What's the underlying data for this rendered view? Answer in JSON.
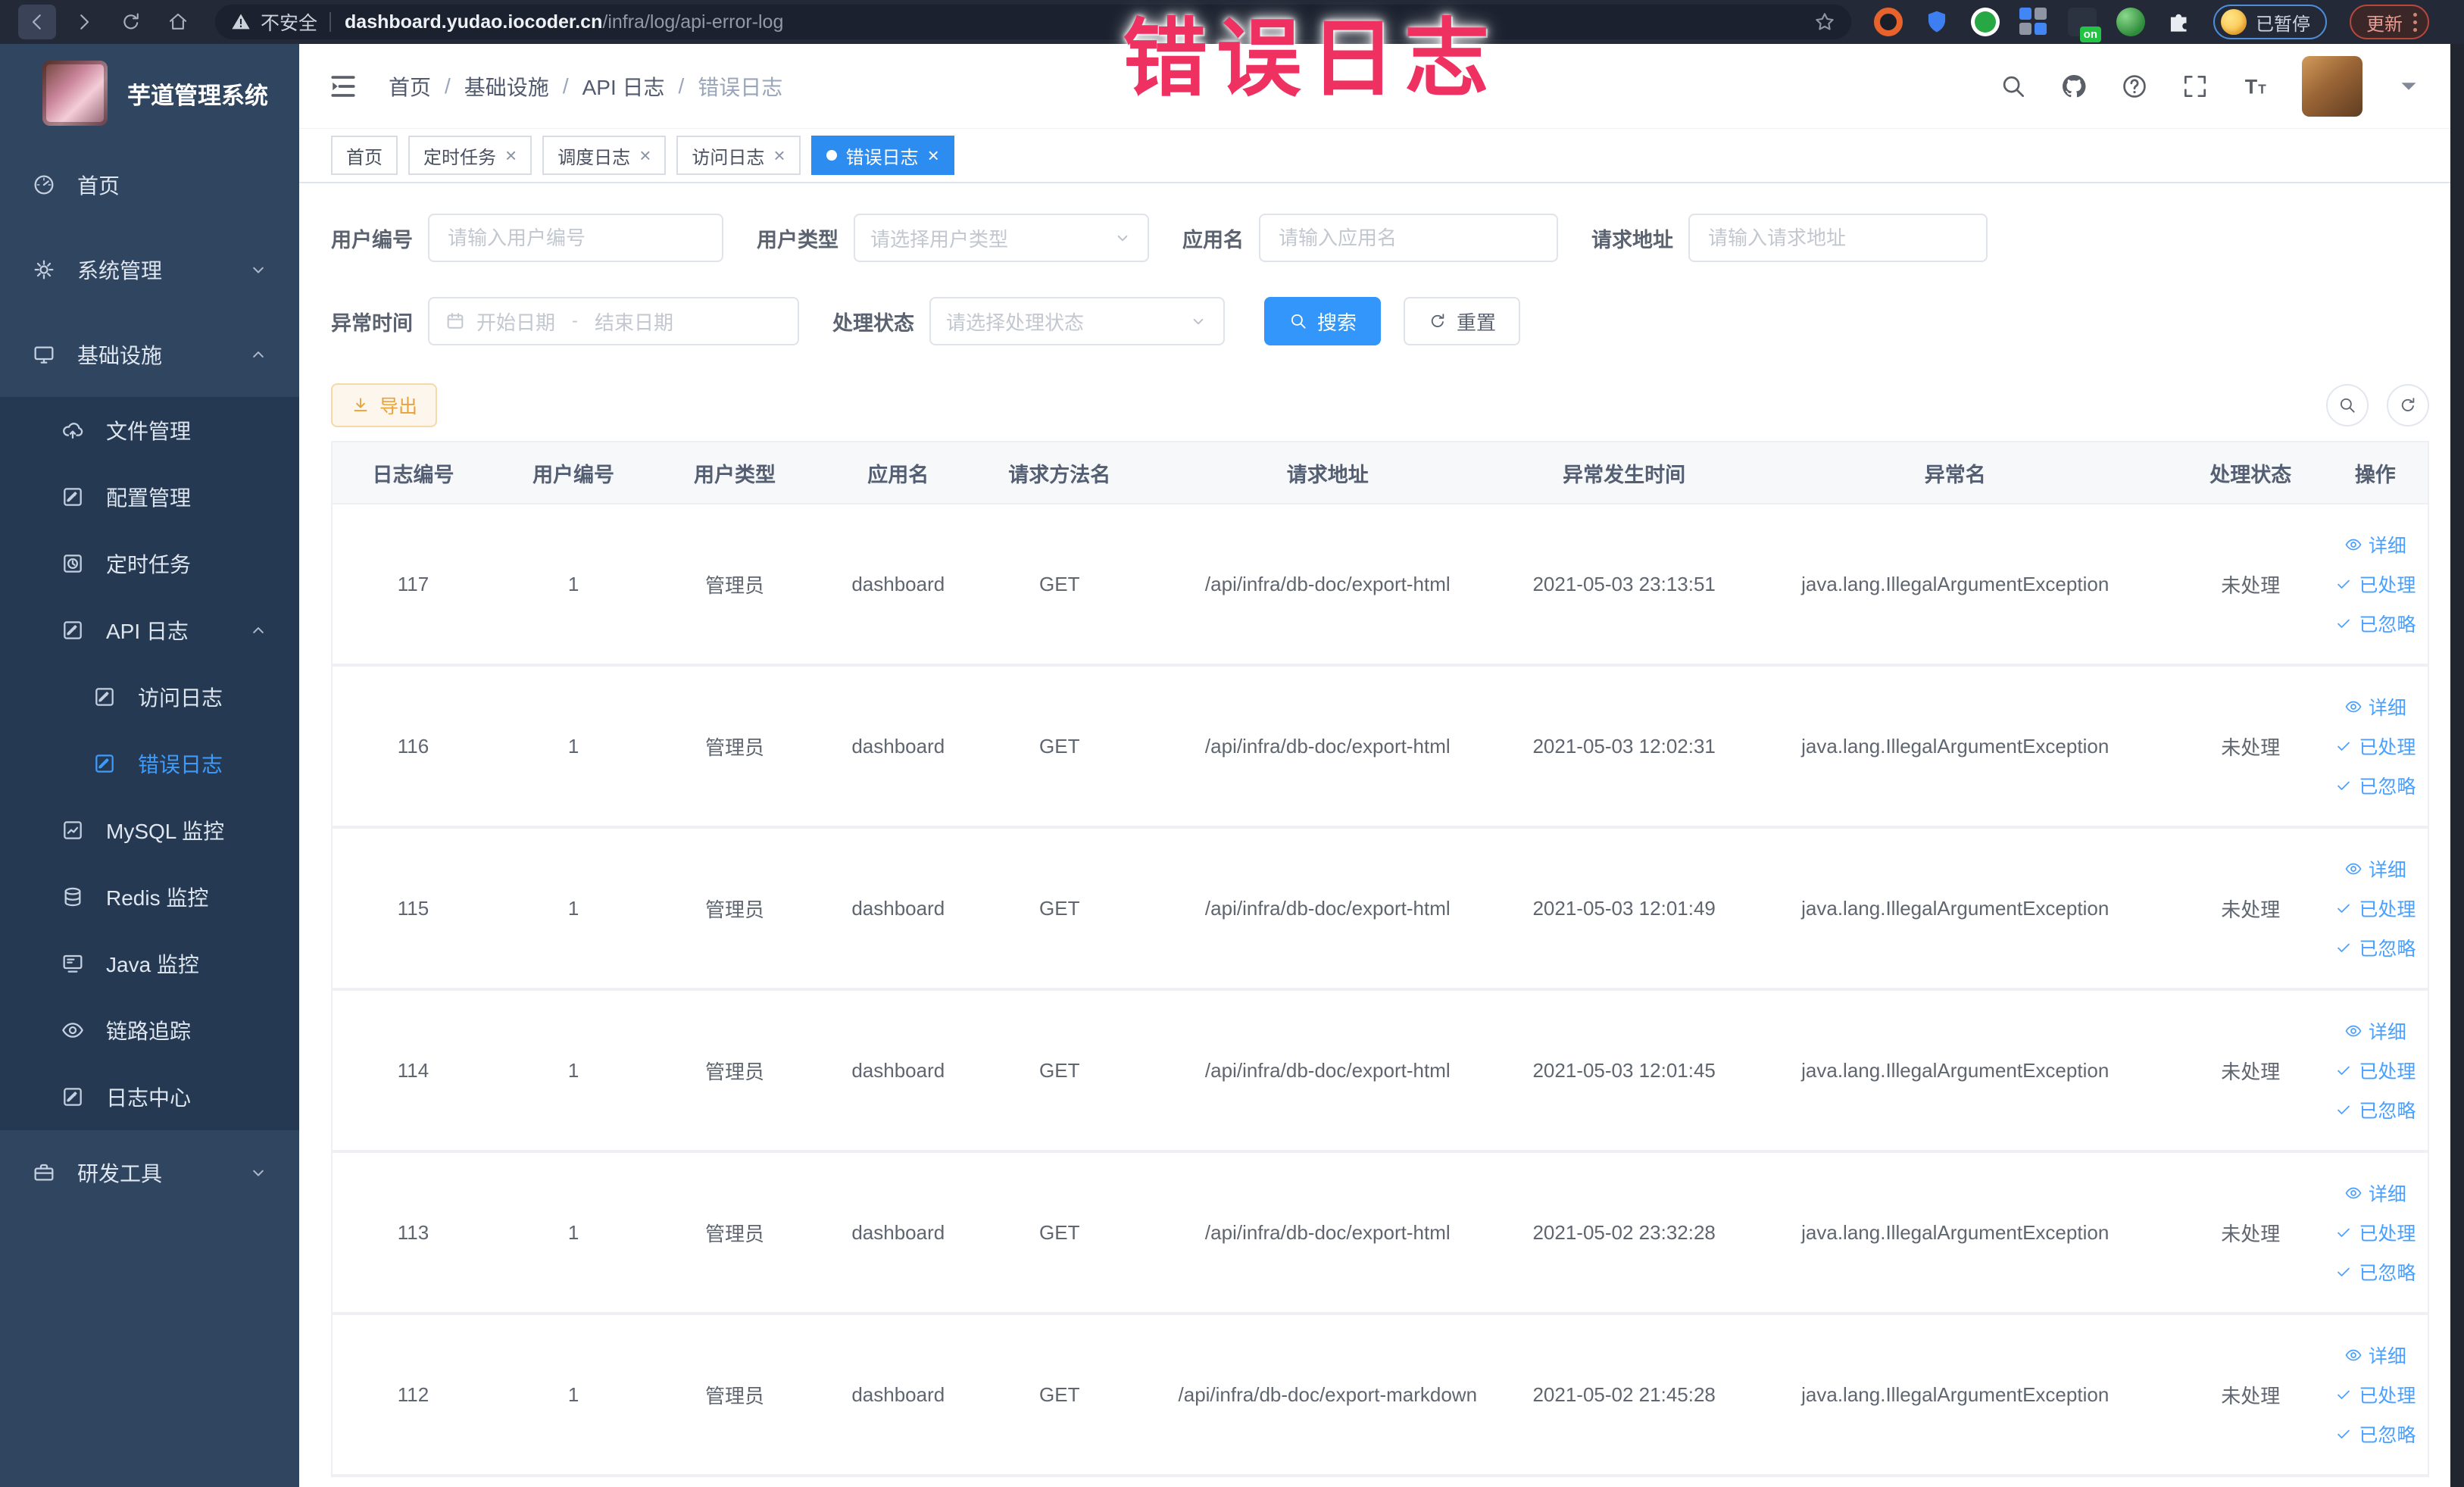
{
  "annotation": {
    "text": "错误日志"
  },
  "browser": {
    "security_text": "不安全",
    "url_host": "dashboard.yudao.iocoder.cn",
    "url_path": "/infra/log/api-error-log",
    "extension_badge": "on",
    "paused_badge": "已暂停",
    "update_button": "更新"
  },
  "sidebar": {
    "title": "芋道管理系统",
    "menu": [
      {
        "label": "首页",
        "icon": "gauge",
        "level": 1,
        "sub": false
      },
      {
        "label": "系统管理",
        "icon": "gear",
        "level": 1,
        "sub": false,
        "arrow": "down"
      },
      {
        "label": "基础设施",
        "icon": "monitor",
        "level": 1,
        "sub": false,
        "arrow": "up"
      },
      {
        "label": "文件管理",
        "icon": "cloudup",
        "level": 2,
        "sub": true
      },
      {
        "label": "配置管理",
        "icon": "pensq",
        "level": 2,
        "sub": true
      },
      {
        "label": "定时任务",
        "icon": "clocksq",
        "level": 2,
        "sub": true
      },
      {
        "label": "API 日志",
        "icon": "pensq",
        "level": 2,
        "sub": true,
        "arrow": "up"
      },
      {
        "label": "访问日志",
        "icon": "pensq",
        "level": 3,
        "sub": true
      },
      {
        "label": "错误日志",
        "icon": "pensq",
        "level": 3,
        "sub": true,
        "active": true
      },
      {
        "label": "MySQL 监控",
        "icon": "chart",
        "level": 2,
        "sub": true
      },
      {
        "label": "Redis 监控",
        "icon": "db",
        "level": 2,
        "sub": true
      },
      {
        "label": "Java 监控",
        "icon": "screen",
        "level": 2,
        "sub": true
      },
      {
        "label": "链路追踪",
        "icon": "eye",
        "level": 2,
        "sub": true
      },
      {
        "label": "日志中心",
        "icon": "pensq",
        "level": 2,
        "sub": true
      },
      {
        "label": "研发工具",
        "icon": "toolbox",
        "level": 1,
        "sub": false,
        "arrow": "down"
      }
    ]
  },
  "navbar": {
    "breadcrumbs": [
      "首页",
      "基础设施",
      "API 日志",
      "错误日志"
    ]
  },
  "tags": [
    {
      "label": "首页",
      "closable": false,
      "active": false
    },
    {
      "label": "定时任务",
      "closable": true,
      "active": false
    },
    {
      "label": "调度日志",
      "closable": true,
      "active": false
    },
    {
      "label": "访问日志",
      "closable": true,
      "active": false
    },
    {
      "label": "错误日志",
      "closable": true,
      "active": true
    }
  ],
  "filters": {
    "user_id_label": "用户编号",
    "user_id_placeholder": "请输入用户编号",
    "user_type_label": "用户类型",
    "user_type_placeholder": "请选择用户类型",
    "app_name_label": "应用名",
    "app_name_placeholder": "请输入应用名",
    "request_url_label": "请求地址",
    "request_url_placeholder": "请输入请求地址",
    "time_label": "异常时间",
    "time_start_placeholder": "开始日期",
    "time_separator": "-",
    "time_end_placeholder": "结束日期",
    "status_label": "处理状态",
    "status_placeholder": "请选择处理状态",
    "search_button": "搜索",
    "reset_button": "重置",
    "export_button": "导出"
  },
  "table": {
    "columns": [
      "日志编号",
      "用户编号",
      "用户类型",
      "应用名",
      "请求方法名",
      "请求地址",
      "异常发生时间",
      "异常名",
      "处理状态",
      "操作"
    ],
    "actions": [
      "详细",
      "已处理",
      "已忽略"
    ],
    "rows": [
      {
        "log_id": "117",
        "user_id": "1",
        "user_type": "管理员",
        "app_name": "dashboard",
        "method": "GET",
        "url": "/api/infra/db-doc/export-html",
        "time": "2021-05-03 23:13:51",
        "exception": "java.lang.IllegalArgumentException",
        "status": "未处理"
      },
      {
        "log_id": "116",
        "user_id": "1",
        "user_type": "管理员",
        "app_name": "dashboard",
        "method": "GET",
        "url": "/api/infra/db-doc/export-html",
        "time": "2021-05-03 12:02:31",
        "exception": "java.lang.IllegalArgumentException",
        "status": "未处理"
      },
      {
        "log_id": "115",
        "user_id": "1",
        "user_type": "管理员",
        "app_name": "dashboard",
        "method": "GET",
        "url": "/api/infra/db-doc/export-html",
        "time": "2021-05-03 12:01:49",
        "exception": "java.lang.IllegalArgumentException",
        "status": "未处理"
      },
      {
        "log_id": "114",
        "user_id": "1",
        "user_type": "管理员",
        "app_name": "dashboard",
        "method": "GET",
        "url": "/api/infra/db-doc/export-html",
        "time": "2021-05-03 12:01:45",
        "exception": "java.lang.IllegalArgumentException",
        "status": "未处理"
      },
      {
        "log_id": "113",
        "user_id": "1",
        "user_type": "管理员",
        "app_name": "dashboard",
        "method": "GET",
        "url": "/api/infra/db-doc/export-html",
        "time": "2021-05-02 23:32:28",
        "exception": "java.lang.IllegalArgumentException",
        "status": "未处理"
      },
      {
        "log_id": "112",
        "user_id": "1",
        "user_type": "管理员",
        "app_name": "dashboard",
        "method": "GET",
        "url": "/api/infra/db-doc/export-markdown",
        "time": "2021-05-02 21:45:28",
        "exception": "java.lang.IllegalArgumentException",
        "status": "未处理"
      }
    ]
  },
  "colors": {
    "primary": "#3296fa",
    "active_tag": "#2d8cf0",
    "link_blue": "#4aa0ff",
    "warning": "#e6a23c",
    "sidebar_bg": "#2f4560",
    "sidebar_sub_bg": "#253a52",
    "annotation_red": "#ee3160",
    "chrome_bg": "#232936"
  }
}
